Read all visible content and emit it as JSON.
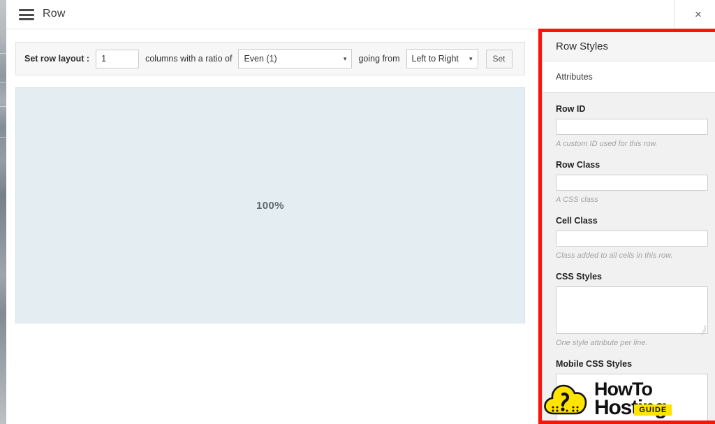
{
  "window": {
    "title": "Row",
    "menu_icon": "hamburger-icon",
    "close_label": "×"
  },
  "toolbar": {
    "row_layout_label": "Set row layout :",
    "columns_value": "1",
    "columns_placeholder": "",
    "columns_middle_text": "columns with a ratio of",
    "ratio_selected": "Even (1)",
    "going_from_text": "going from",
    "direction_selected": "Left to Right",
    "set_label": "Set",
    "caret_glyph": "▾"
  },
  "canvas": {
    "column_width_label": "100%"
  },
  "sidebar": {
    "title": "Row Styles",
    "tabs": [
      {
        "label": "Attributes",
        "active": true
      }
    ],
    "fields": [
      {
        "label": "Row ID",
        "type": "text",
        "value": "",
        "help": "A custom ID used for this row."
      },
      {
        "label": "Row Class",
        "type": "text",
        "value": "",
        "help": "A CSS class"
      },
      {
        "label": "Cell Class",
        "type": "text",
        "value": "",
        "help": "Class added to all cells in this row."
      },
      {
        "label": "CSS Styles",
        "type": "textarea",
        "value": "",
        "help": "One style attribute per line."
      },
      {
        "label": "Mobile CSS Styles",
        "type": "textarea",
        "value": "",
        "help": ""
      }
    ]
  },
  "watermark": {
    "line1": "HowTo",
    "line2": "Hosting",
    "badge": "GUIDE",
    "cloud_icon": "cloud-question-icon"
  },
  "colors": {
    "highlight": "#fb1209",
    "canvas_fill": "#e4edf2",
    "sidebar_bg": "#f1f1f1",
    "logo_yellow": "#ffe400"
  }
}
